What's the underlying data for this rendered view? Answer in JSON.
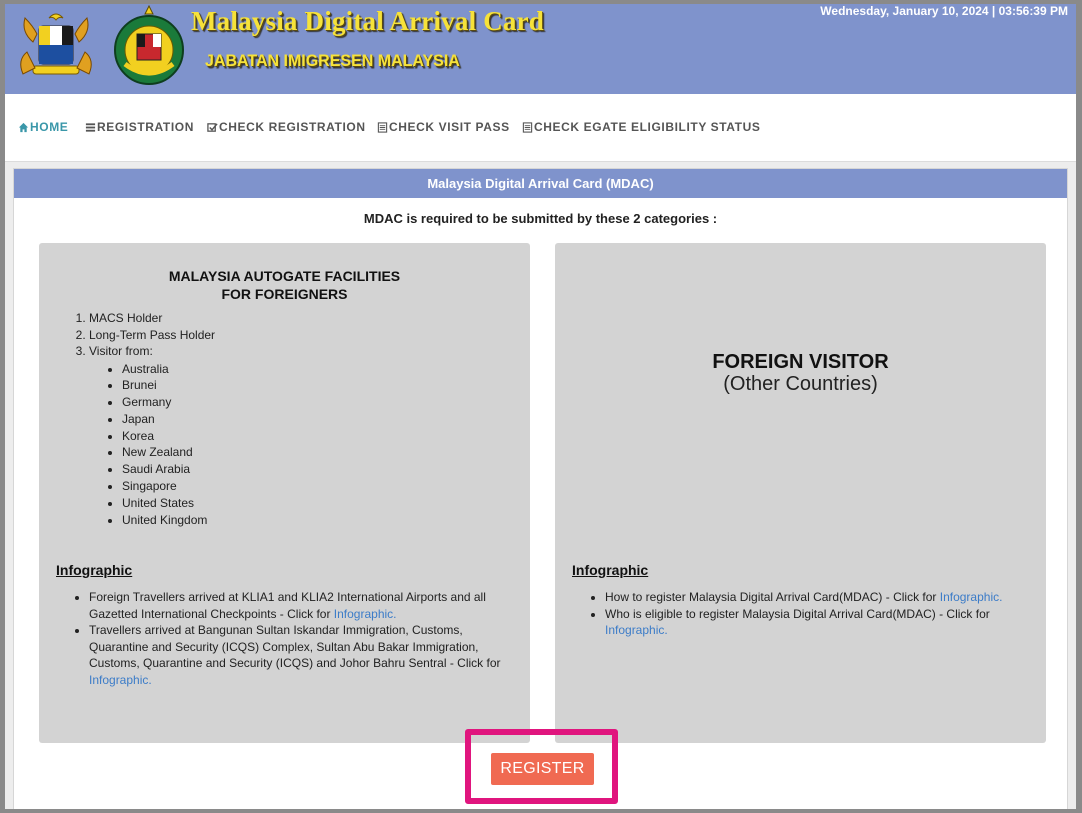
{
  "header": {
    "title": "Malaysia Digital Arrival Card",
    "subtitle": "JABATAN IMIGRESEN MALAYSIA",
    "datetime": "Wednesday, January 10, 2024 | 03:56:39 PM",
    "crest_label": "IMIGRESEN MALAYSIA"
  },
  "nav": {
    "items": [
      {
        "label": "HOME",
        "icon": "home-icon",
        "active": true
      },
      {
        "label": "REGISTRATION",
        "icon": "list-icon"
      },
      {
        "label": "CHECK REGISTRATION",
        "icon": "check-square-icon"
      },
      {
        "label": "CHECK VISIT PASS",
        "icon": "document-icon"
      },
      {
        "label": "CHECK EGATE ELIGIBILITY STATUS",
        "icon": "document-icon"
      }
    ]
  },
  "panel": {
    "header": "Malaysia Digital Arrival Card (MDAC)",
    "requirement": "MDAC is required to be submitted by these 2 categories :"
  },
  "autogate": {
    "title_line1": "MALAYSIA AUTOGATE FACILITIES",
    "title_line2": "FOR FOREIGNERS",
    "items": [
      "MACS Holder",
      "Long-Term Pass Holder",
      "Visitor from:"
    ],
    "countries": [
      "Australia",
      "Brunei",
      "Germany",
      "Japan",
      "Korea",
      "New Zealand",
      "Saudi Arabia",
      "Singapore",
      "United States",
      "United Kingdom"
    ],
    "infographic_heading": "Infographic",
    "info": [
      {
        "text": "Foreign Travellers arrived at KLIA1 and KLIA2 International Airports and all Gazetted International Checkpoints - Click for ",
        "link": "Infographic."
      },
      {
        "text": "Travellers arrived at Bangunan Sultan Iskandar Immigration, Customs, Quarantine and Security (ICQS) Complex, Sultan Abu Bakar Immigration, Customs, Quarantine and Security (ICQS) and Johor Bahru Sentral - Click for ",
        "link": "Infographic."
      }
    ]
  },
  "foreign": {
    "title": "FOREIGN VISITOR",
    "subtitle": "(Other Countries)",
    "infographic_heading": "Infographic",
    "info": [
      {
        "text": "How to register Malaysia Digital Arrival Card(MDAC) - Click for ",
        "link": "Infographic."
      },
      {
        "text": "Who is eligible to register Malaysia Digital Arrival Card(MDAC) - Click for ",
        "link": "Infographic."
      }
    ]
  },
  "register_label": "REGISTER",
  "colors": {
    "banner": "#7f93cc",
    "title_gold": "#f6e23a",
    "nav_active": "#3a97a9",
    "link": "#3c7cc8",
    "register": "#f06a52",
    "highlight": "#e0157e",
    "box_bg": "#d3d3d3"
  }
}
